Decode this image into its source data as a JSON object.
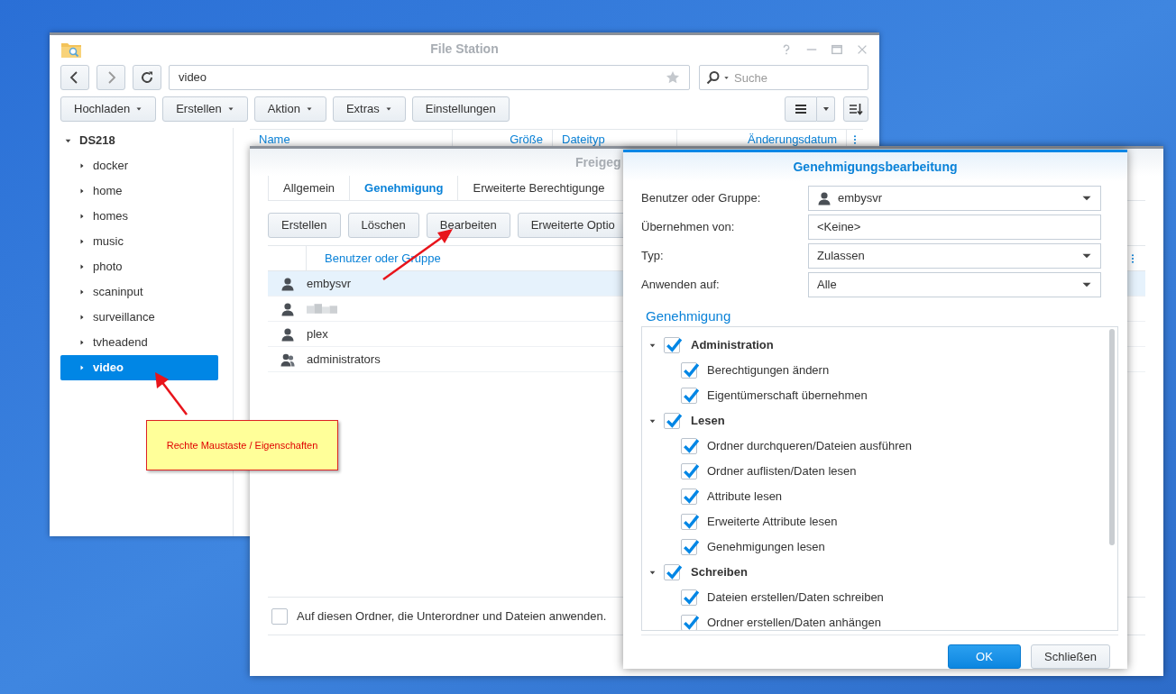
{
  "file_station": {
    "title": "File Station",
    "path": "video",
    "search": {
      "placeholder": "Suche"
    },
    "toolbar": [
      {
        "label": "Hochladen",
        "dropdown": true
      },
      {
        "label": "Erstellen",
        "dropdown": true
      },
      {
        "label": "Aktion",
        "dropdown": true
      },
      {
        "label": "Extras",
        "dropdown": true
      },
      {
        "label": "Einstellungen",
        "dropdown": false
      }
    ],
    "columns": [
      "Name",
      "Größe",
      "Dateityp",
      "Änderungsdatum"
    ],
    "tree": {
      "label": "DS218",
      "expanded": true,
      "children": [
        {
          "label": "docker",
          "expanded": false,
          "selected": false
        },
        {
          "label": "home",
          "expanded": false,
          "selected": false
        },
        {
          "label": "homes",
          "expanded": false,
          "selected": false
        },
        {
          "label": "music",
          "expanded": false,
          "selected": false
        },
        {
          "label": "photo",
          "expanded": false,
          "selected": false
        },
        {
          "label": "scaninput",
          "expanded": false,
          "selected": false
        },
        {
          "label": "surveillance",
          "expanded": false,
          "selected": false
        },
        {
          "label": "tvheadend",
          "expanded": false,
          "selected": false
        },
        {
          "label": "video",
          "expanded": false,
          "selected": true
        }
      ]
    }
  },
  "properties_dialog": {
    "title": "Freigeg",
    "tabs": [
      {
        "label": "Allgemein",
        "selected": false
      },
      {
        "label": "Genehmigung",
        "selected": true
      },
      {
        "label": "Erweiterte Berechtigunge",
        "selected": false
      }
    ],
    "buttons": [
      "Erstellen",
      "Löschen",
      "Bearbeiten",
      "Erweiterte Optio"
    ],
    "column": "Benutzer oder Gruppe",
    "rows": [
      {
        "name": "embysvr",
        "kind": "user",
        "selected": true
      },
      {
        "kind": "user",
        "redacted": true,
        "selected": false
      },
      {
        "name": "plex",
        "kind": "user",
        "selected": false
      },
      {
        "name": "administrators",
        "kind": "group",
        "selected": false
      }
    ],
    "apply_checkbox": {
      "label": "Auf diesen Ordner, die Unterordner und Dateien anwenden.",
      "checked": false
    }
  },
  "permission_editor": {
    "title": "Genehmigungsbearbeitung",
    "fields": [
      {
        "label": "Benutzer oder Gruppe:",
        "value": "embysvr",
        "kind": "select",
        "user_icon": true
      },
      {
        "label": "Übernehmen von:",
        "value": "<Keine>",
        "kind": "text"
      },
      {
        "label": "Typ:",
        "value": "Zulassen",
        "kind": "select"
      },
      {
        "label": "Anwenden auf:",
        "value": "Alle",
        "kind": "select"
      }
    ],
    "section": "Genehmigung",
    "permissions": [
      {
        "label": "Administration",
        "checked": true,
        "expanded": true,
        "children": [
          {
            "label": "Berechtigungen ändern",
            "checked": true
          },
          {
            "label": "Eigentümerschaft übernehmen",
            "checked": true
          }
        ]
      },
      {
        "label": "Lesen",
        "checked": true,
        "expanded": true,
        "children": [
          {
            "label": "Ordner durchqueren/Dateien ausführen",
            "checked": true
          },
          {
            "label": "Ordner auflisten/Daten lesen",
            "checked": true
          },
          {
            "label": "Attribute lesen",
            "checked": true
          },
          {
            "label": "Erweiterte Attribute lesen",
            "checked": true
          },
          {
            "label": "Genehmigungen lesen",
            "checked": true
          }
        ]
      },
      {
        "label": "Schreiben",
        "checked": true,
        "expanded": true,
        "children": [
          {
            "label": "Dateien erstellen/Daten schreiben",
            "checked": true
          },
          {
            "label": "Ordner erstellen/Daten anhängen",
            "checked": true
          }
        ]
      }
    ],
    "buttons": [
      {
        "label": "OK",
        "primary": true
      },
      {
        "label": "Schließen",
        "primary": false
      }
    ]
  },
  "annotation": {
    "note": "Rechte Maustaste / Eigenschaften"
  }
}
